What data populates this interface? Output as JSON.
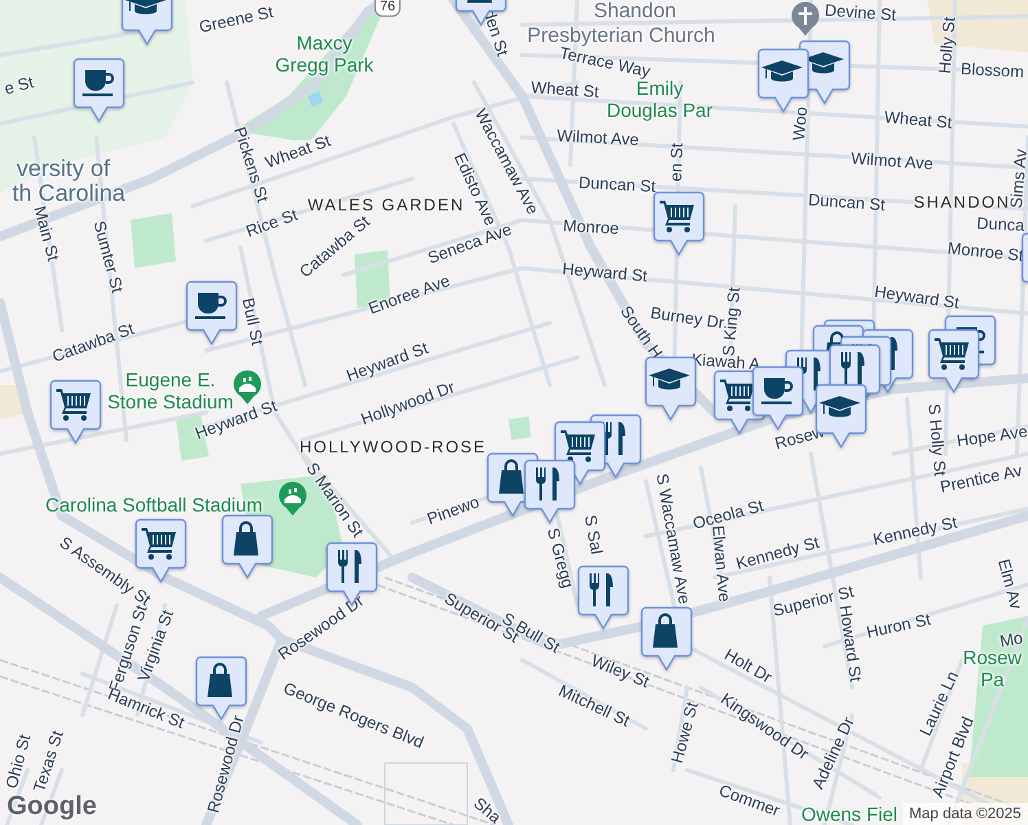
{
  "labels": [
    {
      "text": "Greene St",
      "kind": "street"
    },
    {
      "text": "76",
      "kind": "shield"
    },
    {
      "text": "den St",
      "kind": "street"
    },
    {
      "text": "Shandon",
      "kind": "poi"
    },
    {
      "text": "Devine St",
      "kind": "street"
    },
    {
      "text": "Presbyterian Church",
      "kind": "poi"
    },
    {
      "text": "Maxcy Gregg Park",
      "kind": "park"
    },
    {
      "text": "Holly St",
      "kind": "street"
    },
    {
      "text": "Terrace Way",
      "kind": "street"
    },
    {
      "text": "Blossom",
      "kind": "street"
    },
    {
      "text": "e St",
      "kind": "street"
    },
    {
      "text": "Wheat St",
      "kind": "street"
    },
    {
      "text": "Emily Douglas Par",
      "kind": "park"
    },
    {
      "text": "Woo",
      "kind": "street"
    },
    {
      "text": "Wheat St",
      "kind": "street"
    },
    {
      "text": "Wilmot Ave",
      "kind": "street"
    },
    {
      "text": "Wheat St",
      "kind": "street"
    },
    {
      "text": "Waccamaw Ave",
      "kind": "street"
    },
    {
      "text": "Pickens St",
      "kind": "street"
    },
    {
      "text": "Wilmot Ave",
      "kind": "street"
    },
    {
      "text": "en St",
      "kind": "street"
    },
    {
      "text": "versity of",
      "kind": "campus"
    },
    {
      "text": "th Carolina",
      "kind": "campus"
    },
    {
      "text": "Sims Av",
      "kind": "street"
    },
    {
      "text": "Duncan St",
      "kind": "street"
    },
    {
      "text": "Edisto Ave",
      "kind": "street"
    },
    {
      "text": "Duncan St",
      "kind": "street"
    },
    {
      "text": "WALES GARDEN",
      "kind": "area"
    },
    {
      "text": "SHANDON",
      "kind": "area"
    },
    {
      "text": "Rice St",
      "kind": "street"
    },
    {
      "text": "Dunca",
      "kind": "street"
    },
    {
      "text": "Main St",
      "kind": "street"
    },
    {
      "text": "Monroe",
      "kind": "street"
    },
    {
      "text": "Seneca Ave",
      "kind": "street"
    },
    {
      "text": "Catawba St",
      "kind": "street"
    },
    {
      "text": "Monroe St",
      "kind": "street"
    },
    {
      "text": "Sumter St",
      "kind": "street"
    },
    {
      "text": "Heyward St",
      "kind": "street"
    },
    {
      "text": "Heyward St",
      "kind": "street"
    },
    {
      "text": "Enoree Ave",
      "kind": "street"
    },
    {
      "text": "Bull St",
      "kind": "street"
    },
    {
      "text": "Burney Dr",
      "kind": "street"
    },
    {
      "text": "S King St",
      "kind": "street"
    },
    {
      "text": "Catawba St",
      "kind": "street"
    },
    {
      "text": "South H",
      "kind": "street"
    },
    {
      "text": "Kiawah A",
      "kind": "street"
    },
    {
      "text": "Heyward St",
      "kind": "street"
    },
    {
      "text": "Eugene E. Stone Stadium",
      "kind": "park"
    },
    {
      "text": "Hollywood Dr",
      "kind": "street"
    },
    {
      "text": "Heyward St",
      "kind": "street"
    },
    {
      "text": "Rosew",
      "kind": "street"
    },
    {
      "text": "Hope Ave",
      "kind": "street"
    },
    {
      "text": "S Holly St",
      "kind": "street"
    },
    {
      "text": "HOLLYWOOD-ROSE",
      "kind": "area"
    },
    {
      "text": "Prentice Av",
      "kind": "street"
    },
    {
      "text": "Carolina Softball Stadium",
      "kind": "park"
    },
    {
      "text": "Pinewo",
      "kind": "street"
    },
    {
      "text": "S Marion St",
      "kind": "street"
    },
    {
      "text": "Oceola St",
      "kind": "street"
    },
    {
      "text": "Kennedy St",
      "kind": "street"
    },
    {
      "text": "S Waccamaw Ave",
      "kind": "street"
    },
    {
      "text": "S Sal",
      "kind": "street"
    },
    {
      "text": "Elwan Ave",
      "kind": "street"
    },
    {
      "text": "S Gregg",
      "kind": "street"
    },
    {
      "text": "Kennedy St",
      "kind": "street"
    },
    {
      "text": "S Assembly St",
      "kind": "street"
    },
    {
      "text": "Rosewood Dr",
      "kind": "street"
    },
    {
      "text": "Elm Av",
      "kind": "street"
    },
    {
      "text": "Superior St",
      "kind": "street"
    },
    {
      "text": "Superior St",
      "kind": "street"
    },
    {
      "text": "S Bull St",
      "kind": "street"
    },
    {
      "text": "Huron St",
      "kind": "street"
    },
    {
      "text": "Howard St",
      "kind": "street"
    },
    {
      "text": "Ferguson St",
      "kind": "street"
    },
    {
      "text": "Virginia St",
      "kind": "street"
    },
    {
      "text": "Mo",
      "kind": "street"
    },
    {
      "text": "Holt Dr",
      "kind": "street"
    },
    {
      "text": "Wiley St",
      "kind": "street"
    },
    {
      "text": "Rosew Pa",
      "kind": "park"
    },
    {
      "text": "Hamrick St",
      "kind": "street"
    },
    {
      "text": "Mitchell St",
      "kind": "street"
    },
    {
      "text": "Laurie Ln",
      "kind": "street"
    },
    {
      "text": "George Rogers Blvd",
      "kind": "street"
    },
    {
      "text": "Kingswood Dr",
      "kind": "street"
    },
    {
      "text": "Howe St",
      "kind": "street"
    },
    {
      "text": "Rosewood Dr",
      "kind": "street"
    },
    {
      "text": "Adeline Dr",
      "kind": "street"
    },
    {
      "text": "Airport Blvd",
      "kind": "street"
    },
    {
      "text": "Ohio St",
      "kind": "street"
    },
    {
      "text": "Texas St",
      "kind": "street"
    },
    {
      "text": "Commer",
      "kind": "street"
    },
    {
      "text": "Owens Fiel",
      "kind": "park"
    },
    {
      "text": "Sha",
      "kind": "street"
    }
  ],
  "places": [
    {
      "kind": "church"
    },
    {
      "kind": "stadium"
    },
    {
      "kind": "stadium"
    }
  ],
  "markers": [
    {
      "kind": "school"
    },
    {
      "kind": "shopping"
    },
    {
      "kind": "cafe"
    },
    {
      "kind": "school"
    },
    {
      "kind": "school"
    },
    {
      "kind": "grocery"
    },
    {
      "kind": "restaurant"
    },
    {
      "kind": "cafe"
    },
    {
      "kind": "grocery"
    },
    {
      "kind": "school"
    },
    {
      "kind": "restaurant"
    },
    {
      "kind": "shopping"
    },
    {
      "kind": "restaurant"
    },
    {
      "kind": "restaurant"
    },
    {
      "kind": "restaurant"
    },
    {
      "kind": "cafe"
    },
    {
      "kind": "grocery"
    },
    {
      "kind": "grocery"
    },
    {
      "kind": "cafe"
    },
    {
      "kind": "restaurant"
    },
    {
      "kind": "school"
    },
    {
      "kind": "shopping"
    },
    {
      "kind": "restaurant"
    },
    {
      "kind": "grocery"
    },
    {
      "kind": "restaurant"
    },
    {
      "kind": "grocery"
    },
    {
      "kind": "shopping"
    },
    {
      "kind": "restaurant"
    },
    {
      "kind": "restaurant"
    },
    {
      "kind": "shopping"
    },
    {
      "kind": "shopping"
    }
  ],
  "logo": "Google",
  "attribution": "Map data ©2025"
}
